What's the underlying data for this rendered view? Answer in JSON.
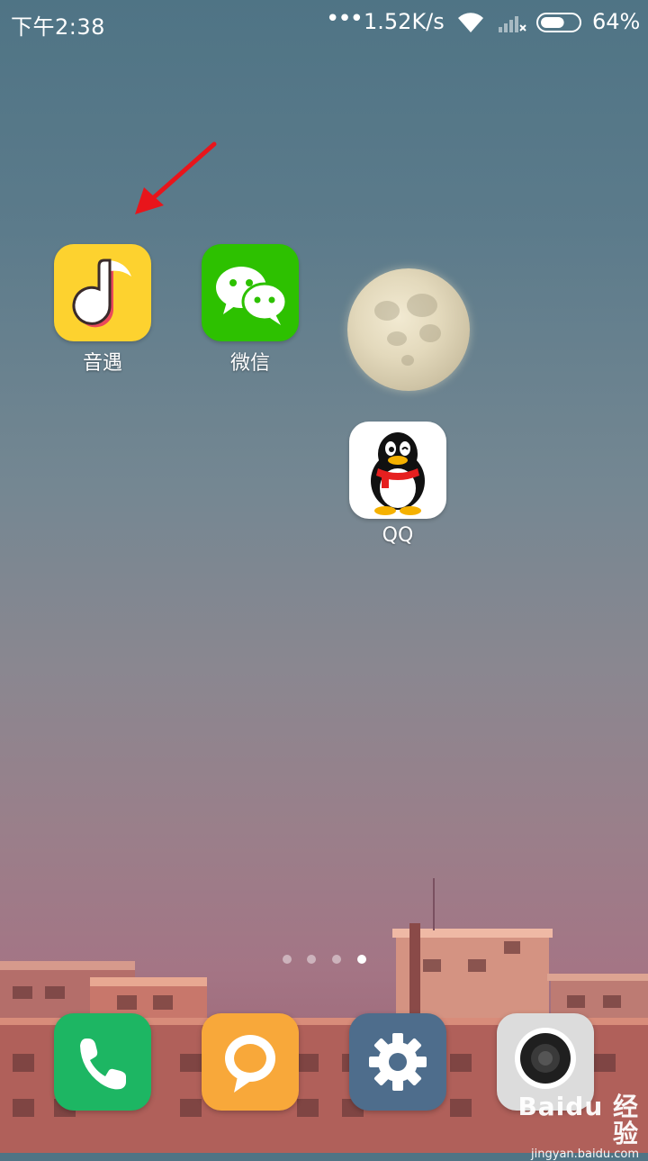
{
  "status_bar": {
    "time": "下午2:38",
    "dots": "•••",
    "network_speed": "1.52K/s",
    "battery_percent": "64%",
    "battery_level": 0.64
  },
  "home": {
    "apps": [
      {
        "label": "音遇",
        "icon": "music-note-icon",
        "color": "#fdd22f"
      },
      {
        "label": "微信",
        "icon": "wechat-icon",
        "color": "#2dc100"
      },
      {
        "label": "QQ",
        "icon": "qq-penguin-icon",
        "color": "#ffffff"
      }
    ]
  },
  "page_indicator": {
    "count": 4,
    "active_index": 3
  },
  "dock": [
    {
      "name": "phone",
      "icon": "phone-icon",
      "color": "#1db663"
    },
    {
      "name": "messages",
      "icon": "message-bubble-icon",
      "color": "#f8a83a"
    },
    {
      "name": "settings",
      "icon": "gear-icon",
      "color": "#4e6d8c"
    },
    {
      "name": "camera",
      "icon": "camera-icon",
      "color": "#dcdcdc"
    }
  ],
  "watermark": {
    "text_big": "Baidu 经验",
    "text_small": "jingyan.baidu.com"
  }
}
